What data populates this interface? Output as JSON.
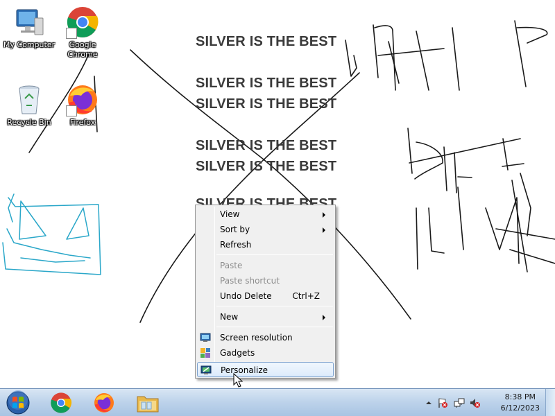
{
  "desktop": {
    "icons": [
      {
        "label": "My Computer",
        "icon": "computer-icon"
      },
      {
        "label": "Google Chrome",
        "icon": "chrome-icon"
      },
      {
        "label": "Recycle Bin",
        "icon": "recycle-bin-icon"
      },
      {
        "label": "Firefox",
        "icon": "firefox-icon"
      }
    ],
    "text_lines": [
      "SILVER IS THE BEST",
      "SILVER IS THE BEST",
      "SILVER IS THE BEST",
      "SILVER IS THE BEST",
      "SILVER IS THE BEST",
      "SILVER IS THE BEST"
    ],
    "colors": {
      "ink": "#1a1a1a",
      "cyan_ink": "#2aa7c9",
      "text": "#3a3a3a"
    }
  },
  "context_menu": {
    "items": [
      {
        "label": "View",
        "submenu": true
      },
      {
        "label": "Sort by",
        "submenu": true
      },
      {
        "label": "Refresh"
      },
      {
        "label": "Paste",
        "disabled": true
      },
      {
        "label": "Paste shortcut",
        "disabled": true
      },
      {
        "label": "Undo Delete",
        "shortcut": "Ctrl+Z"
      },
      {
        "label": "New",
        "submenu": true
      },
      {
        "label": "Screen resolution",
        "icon": "screen-resolution-icon"
      },
      {
        "label": "Gadgets",
        "icon": "gadgets-icon"
      },
      {
        "label": "Personalize",
        "icon": "personalize-icon",
        "highlighted": true
      }
    ]
  },
  "taskbar": {
    "start": {
      "icon": "windows-start-icon"
    },
    "apps": [
      {
        "name": "Google Chrome",
        "icon": "chrome-icon"
      },
      {
        "name": "Firefox",
        "icon": "firefox-icon"
      },
      {
        "name": "Windows Explorer",
        "icon": "folder-icon"
      }
    ],
    "tray": {
      "icons": [
        "show-hidden-icons-arrow",
        "action-center-flag-icon",
        "network-icon",
        "volume-muted-icon"
      ],
      "time": "8:38 PM",
      "date": "6/12/2023"
    },
    "colors": {
      "accent": "#bcd2ea"
    }
  }
}
